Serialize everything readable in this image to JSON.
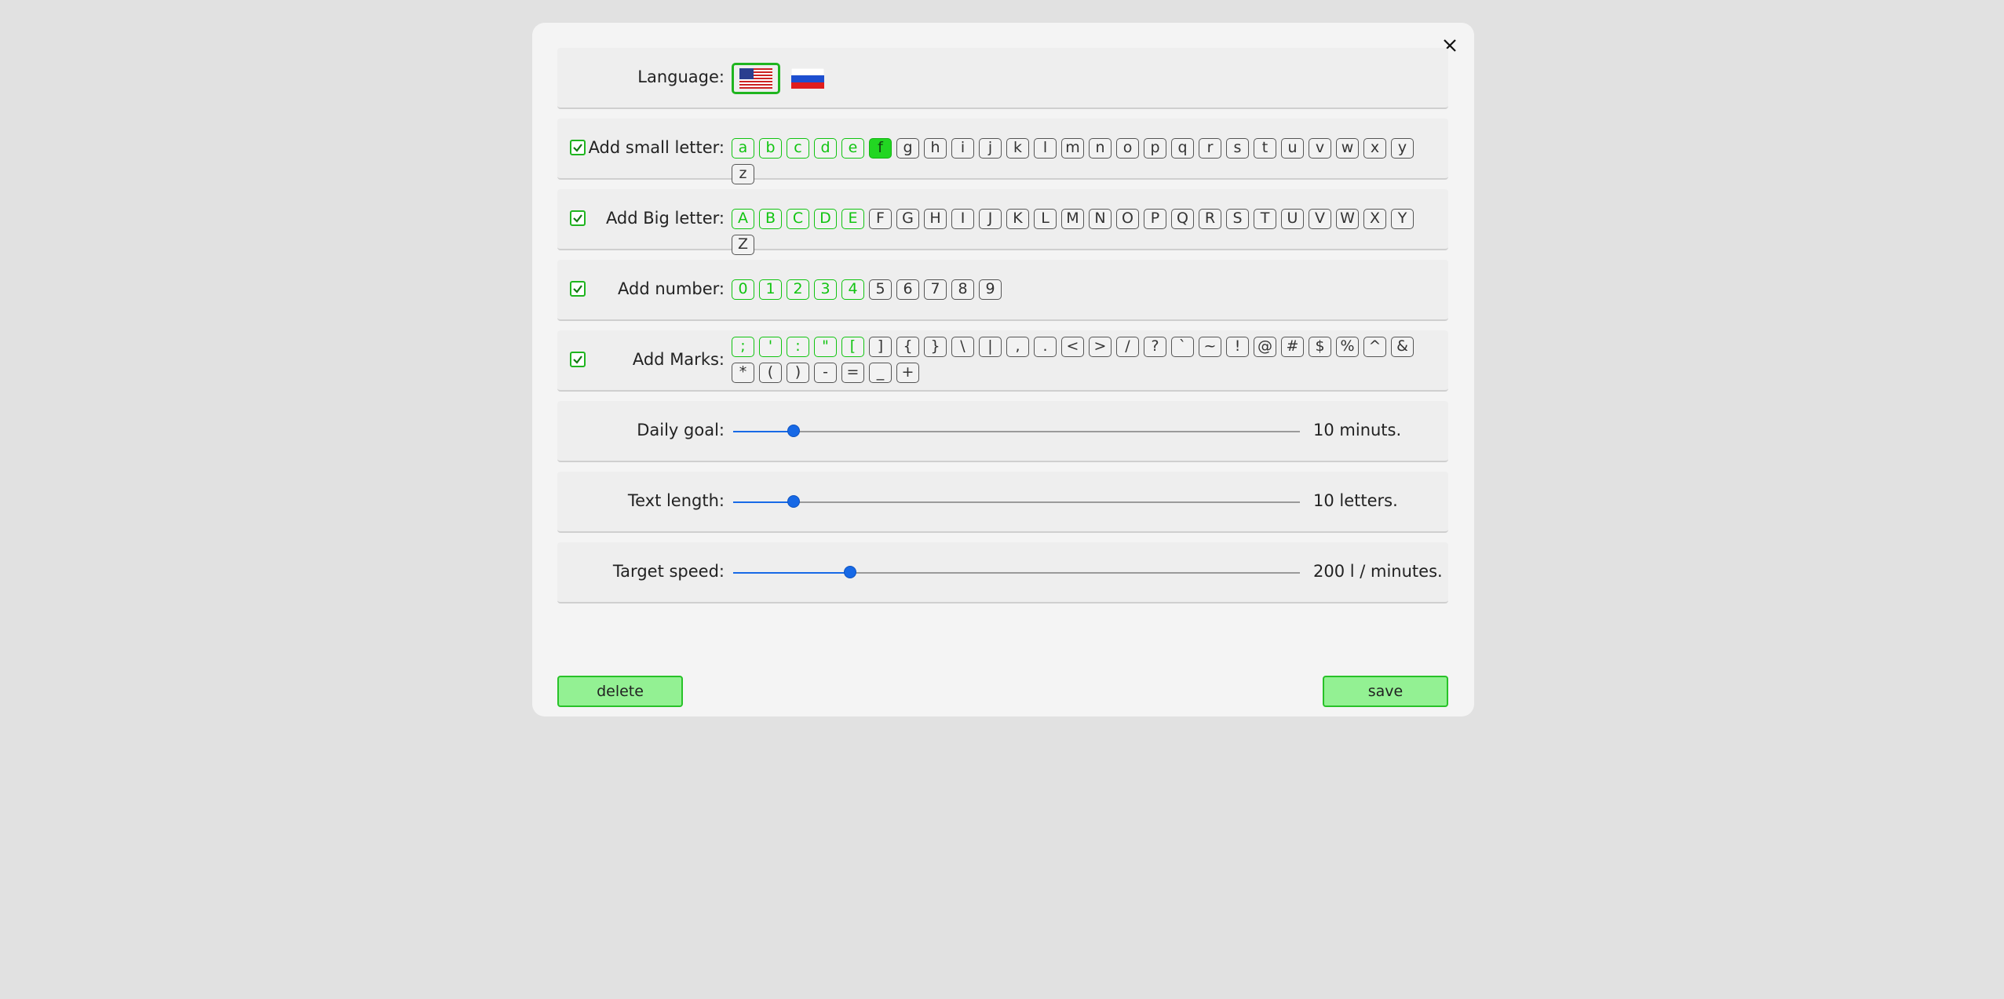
{
  "settings": {
    "language_label": "Language:",
    "flags": [
      {
        "name": "us-flag",
        "selected": true
      },
      {
        "name": "ru-flag",
        "selected": false
      }
    ],
    "small_letters": {
      "label": "Add small letter:",
      "checked": true,
      "keys": [
        "a",
        "b",
        "c",
        "d",
        "e",
        "f",
        "g",
        "h",
        "i",
        "j",
        "k",
        "l",
        "m",
        "n",
        "o",
        "p",
        "q",
        "r",
        "s",
        "t",
        "u",
        "v",
        "w",
        "x",
        "y",
        "z"
      ],
      "selected_count": 5,
      "current_index": 5
    },
    "big_letters": {
      "label": "Add Big letter:",
      "checked": true,
      "keys": [
        "A",
        "B",
        "C",
        "D",
        "E",
        "F",
        "G",
        "H",
        "I",
        "J",
        "K",
        "L",
        "M",
        "N",
        "O",
        "P",
        "Q",
        "R",
        "S",
        "T",
        "U",
        "V",
        "W",
        "X",
        "Y",
        "Z"
      ],
      "selected_count": 5,
      "current_index": -1
    },
    "numbers": {
      "label": "Add number:",
      "checked": true,
      "keys": [
        "0",
        "1",
        "2",
        "3",
        "4",
        "5",
        "6",
        "7",
        "8",
        "9"
      ],
      "selected_count": 5,
      "current_index": -1
    },
    "marks": {
      "label": "Add Marks:",
      "checked": true,
      "keys": [
        ";",
        "'",
        ":",
        "\"",
        "[",
        "]",
        "{",
        "}",
        "\\",
        "|",
        ",",
        ".",
        "<",
        ">",
        "/",
        "?",
        "`",
        "~",
        "!",
        "@",
        "#",
        "$",
        "%",
        "^",
        "&",
        "*",
        "(",
        ")",
        "-",
        "=",
        "_",
        "+"
      ],
      "selected_count": 5,
      "current_index": -1
    },
    "daily_goal": {
      "label": "Daily goal:",
      "value_text": "10 minuts.",
      "fraction": 0.107
    },
    "text_length": {
      "label": "Text length:",
      "value_text": "10 letters.",
      "fraction": 0.107
    },
    "target_speed": {
      "label": "Target speed:",
      "value_text": "200 l / minutes.",
      "fraction": 0.207
    }
  },
  "buttons": {
    "delete_label": "delete",
    "save_label": "save"
  },
  "colors": {
    "accent_green": "#1fb51f",
    "button_green": "#93f193",
    "slider_blue": "#1769e6"
  }
}
